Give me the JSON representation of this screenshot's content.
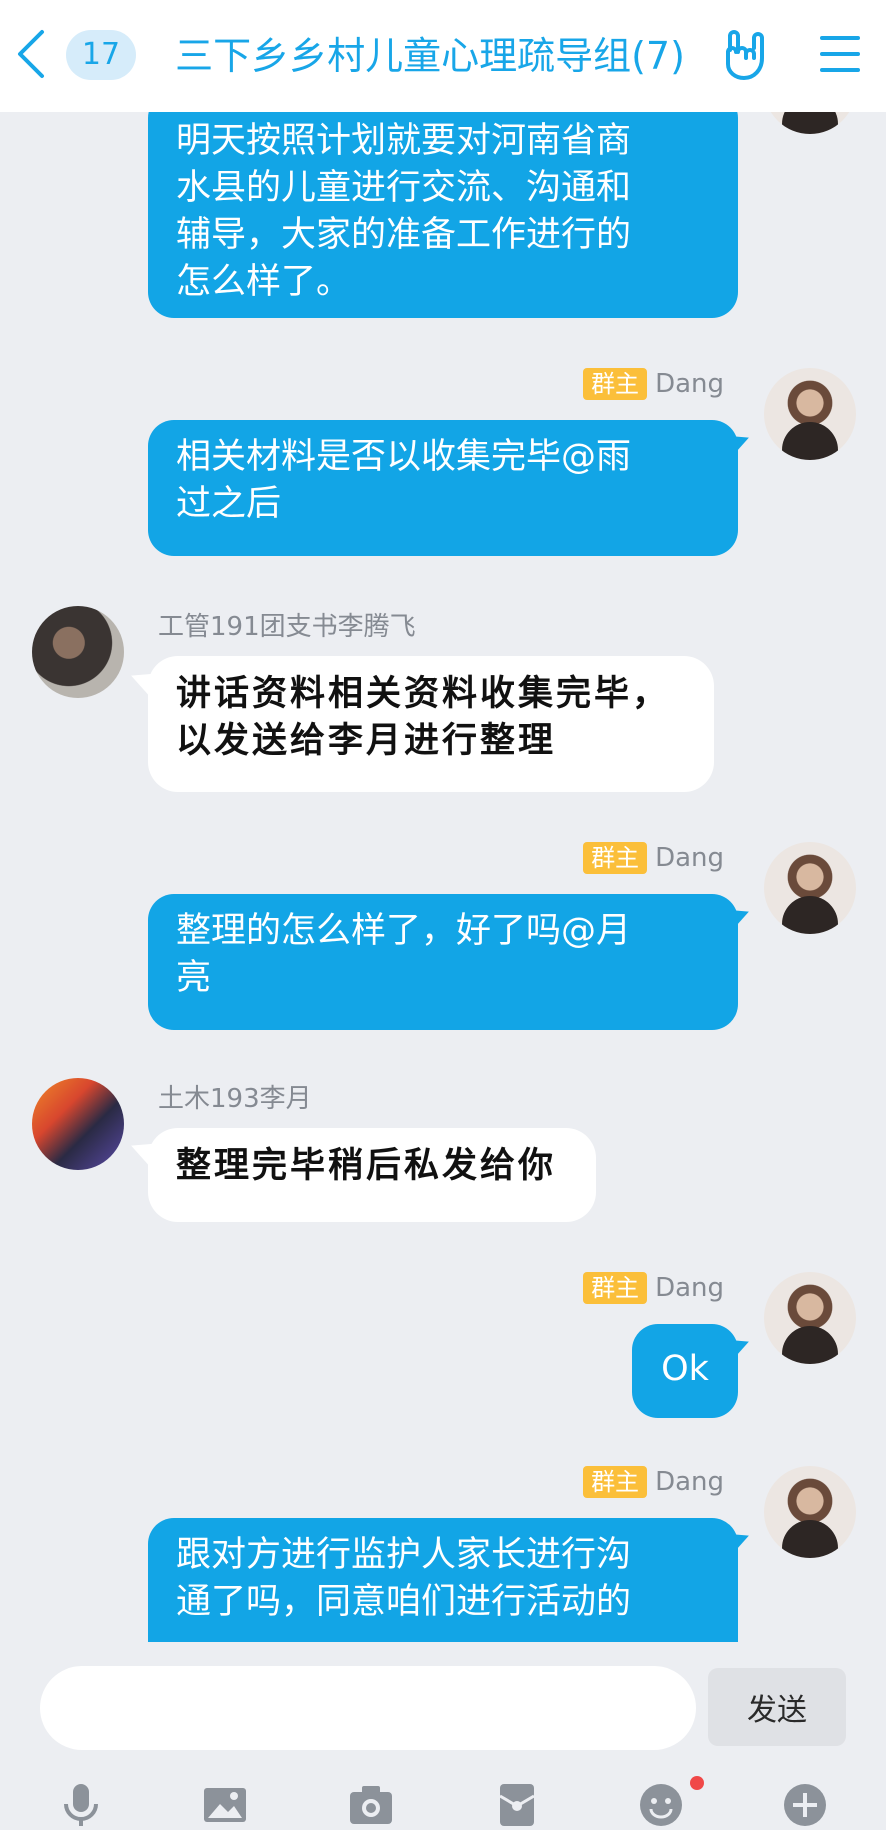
{
  "header": {
    "back_icon": "chevron-left-icon",
    "unread_count": "17",
    "title": "三下乡乡村儿童心理疏导组(7)",
    "accent_color": "#18a6e8"
  },
  "messages": [
    {
      "side": "self",
      "sender": "",
      "tag": "",
      "text_lines": [
        "明天按照计划就要对河南省商",
        "水县的儿童进行交流、沟通和",
        "辅导，大家的准备工作进行的",
        "怎么样了。"
      ]
    },
    {
      "side": "self",
      "sender": "Dang",
      "tag": "群主",
      "text_lines": [
        "相关材料是否以收集完毕@雨",
        "过之后"
      ]
    },
    {
      "side": "other",
      "sender": "工管191团支书李腾飞",
      "tag": "",
      "text_lines": [
        "讲话资料相关资料收集完毕，",
        "以发送给李月进行整理"
      ]
    },
    {
      "side": "self",
      "sender": "Dang",
      "tag": "群主",
      "text_lines": [
        "整理的怎么样了，好了吗@月",
        "亮"
      ]
    },
    {
      "side": "other",
      "sender": "土木193李月",
      "tag": "",
      "text_lines": [
        "整理完毕稍后私发给你"
      ]
    },
    {
      "side": "self",
      "sender": "Dang",
      "tag": "群主",
      "text_lines": [
        "Ok"
      ]
    },
    {
      "side": "self",
      "sender": "Dang",
      "tag": "群主",
      "text_lines": [
        "跟对方进行监护人家长进行沟",
        "通了吗，同意咱们进行活动的"
      ]
    }
  ],
  "input": {
    "placeholder": "",
    "value": "",
    "send_label": "发送"
  },
  "toolbar": [
    "microphone-icon",
    "image-icon",
    "camera-icon",
    "red-packet-icon",
    "emoji-icon",
    "plus-icon"
  ],
  "colors": {
    "self_bubble": "#12a5e6",
    "other_bubble": "#ffffff",
    "owner_tag": "#fbbf3a",
    "background": "#eceef2",
    "notification_dot": "#f04848"
  }
}
